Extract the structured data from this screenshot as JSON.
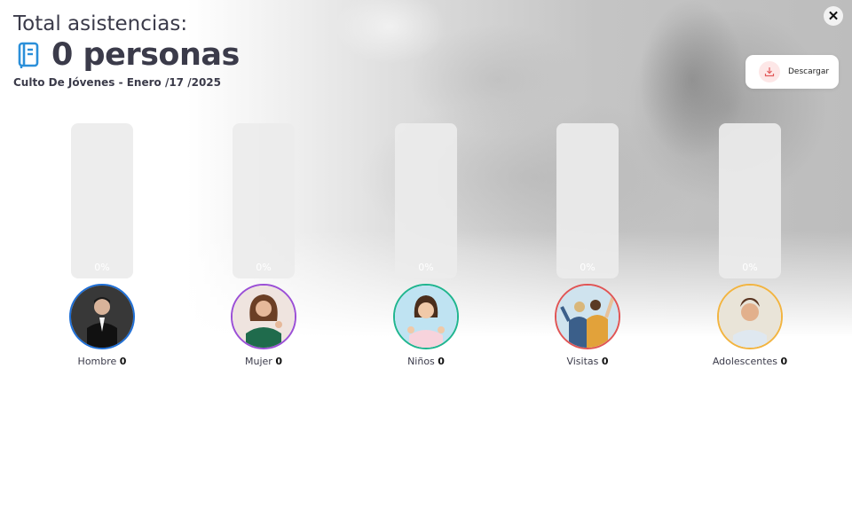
{
  "header": {
    "title": "Total asistencias:",
    "total": "0 personas",
    "subtitle": "Culto De Jóvenes - Enero /17 /2025"
  },
  "actions": {
    "download_label": "Descargar",
    "close_icon": "close-icon",
    "download_icon": "download-icon"
  },
  "colors": {
    "book_icon": "#2b8fd9",
    "download_icon": "#e25b5b"
  },
  "categories": [
    {
      "label": "Hombre",
      "count": "0",
      "percent_text": "0%",
      "percent": 0,
      "ring_color": "#1f6fd6"
    },
    {
      "label": "Mujer",
      "count": "0",
      "percent_text": "0%",
      "percent": 0,
      "ring_color": "#9b4fd6"
    },
    {
      "label": "Niños",
      "count": "0",
      "percent_text": "0%",
      "percent": 0,
      "ring_color": "#1fb58f"
    },
    {
      "label": "Visitas",
      "count": "0",
      "percent_text": "0%",
      "percent": 0,
      "ring_color": "#e05555"
    },
    {
      "label": "Adolescentes",
      "count": "0",
      "percent_text": "0%",
      "percent": 0,
      "ring_color": "#f2b440"
    }
  ]
}
